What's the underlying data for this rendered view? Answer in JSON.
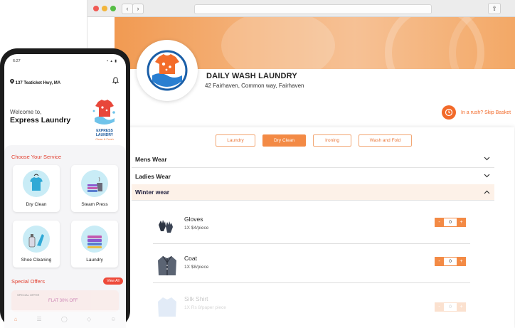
{
  "browser": {
    "nav_back": "‹",
    "nav_forward": "›",
    "share": "⇪"
  },
  "store": {
    "title": "DAILY WASH LAUNDRY",
    "address": "42 Fairhaven, Common way, Fairhaven",
    "rush_text": "In a rush? Skip Basket"
  },
  "tabs": [
    {
      "label": "Laundry",
      "active": false
    },
    {
      "label": "Dry Clean",
      "active": true
    },
    {
      "label": "Ironing",
      "active": false
    },
    {
      "label": "Wash and Fold",
      "active": false
    }
  ],
  "categories": [
    {
      "label": "Mens Wear",
      "open": false
    },
    {
      "label": "Ladies Wear",
      "open": false
    },
    {
      "label": "Winter wear",
      "open": true
    }
  ],
  "items": [
    {
      "name": "Gloves",
      "price": "1X $4/piece",
      "qty": "0",
      "icon": "gloves-icon"
    },
    {
      "name": "Coat",
      "price": "1X $8/piece",
      "qty": "0",
      "icon": "coat-icon"
    },
    {
      "name": "Silk Shirt",
      "price": "1X Rs 8/paper piece",
      "qty": "0",
      "icon": "shirt-icon"
    }
  ],
  "stepper": {
    "minus": "-",
    "plus": "+"
  },
  "phone": {
    "time": "6:27",
    "status_icons": "▪ ▴ ▮",
    "location": "137 Teaticket Hwy, MA",
    "welcome": "Welcome to,",
    "brand": "Express Laundry",
    "logo_caption": "EXPRESS LAUNDRY",
    "logo_tagline": "Clean & Fresh",
    "choose_service": "Choose Your Service",
    "services": [
      {
        "label": "Dry Clean",
        "icon": "dry-clean-icon"
      },
      {
        "label": "Steam Press",
        "icon": "steam-press-icon"
      },
      {
        "label": "Shoe Cleaning",
        "icon": "shoe-cleaning-icon"
      },
      {
        "label": "Laundry",
        "icon": "laundry-icon"
      }
    ],
    "special_offers": "Special Offers",
    "view_all": "View All",
    "offer_label": "SPECIAL OFFER",
    "offer_text": "FLAT 30% OFF"
  },
  "colors": {
    "accent": "#f38a45",
    "accent_dark": "#f26a2a",
    "red": "#e23f2f"
  }
}
